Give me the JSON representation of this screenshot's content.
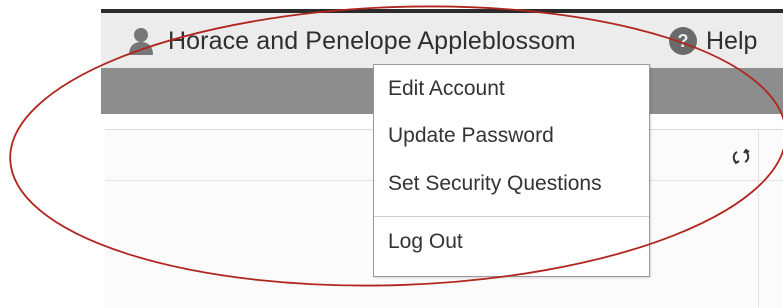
{
  "header": {
    "user_name": "Horace and Penelope Appleblossom",
    "help_label": "Help",
    "user_icon": "user-silhouette-icon",
    "help_icon": "question-circle-icon"
  },
  "menu": {
    "items": [
      {
        "label": "Edit Account"
      },
      {
        "label": "Update Password"
      },
      {
        "label": "Set Security Questions"
      },
      {
        "label": "Log Out"
      }
    ]
  },
  "panel": {
    "refresh_icon": "refresh-icon"
  },
  "colors": {
    "header_bg": "#ececec",
    "band": "#8d8d8d",
    "highlight_oval": "#b0261e",
    "text": "#333333"
  }
}
